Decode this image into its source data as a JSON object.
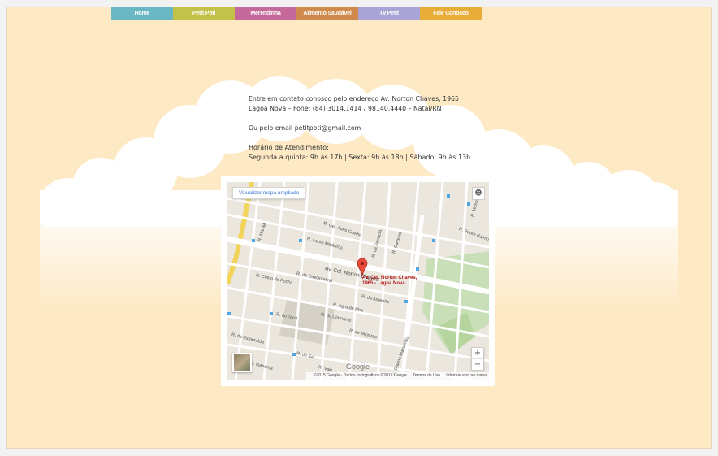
{
  "nav": {
    "items": [
      {
        "label": "Home",
        "color": "#69b7c4"
      },
      {
        "label": "Petit Poti",
        "color": "#c2c24a"
      },
      {
        "label": "Merendinha",
        "color": "#c4699a"
      },
      {
        "label": "Alimento Saudável",
        "color": "#cf8a4b"
      },
      {
        "label": "Tv Petit",
        "color": "#a9a4d6"
      },
      {
        "label": "Fale Conosco",
        "color": "#e8ac38"
      }
    ]
  },
  "contact": {
    "address_line1": "Entre em contato conosco pelo endereço Av. Norton Chaves, 1965",
    "address_line2": "Lagoa Nova – Fone: (84) 3014.1414 / 98140.4440 – Natal/RN",
    "email_prefix": "Ou pelo email ",
    "email": "petitpoti@gmail.com",
    "hours_title": "Horário de Atendimento:",
    "hours_detail": "Segunda a quinta: 9h às 17h | Sexta: 9h às 18h | Sábado: 9h às 13h"
  },
  "map": {
    "view_larger": "Visualizar mapa ampliado",
    "pin_label_line1": "Av. Cel. Norton Chaves,",
    "pin_label_line2": "1965 - Lagoa Nova",
    "google": "Google",
    "zoom_in": "+",
    "zoom_out": "−",
    "attribution": "©2015 Google - Dados cartográficos ©2015 Google",
    "terms": "Termos de Uso",
    "report": "Informar erro no mapa",
    "streets": [
      "Av. Cel. Norton Chaves",
      "R. Cel. Auris Coelho",
      "R. Lauro Medeiros",
      "R. Cristo de Pocha",
      "R. de Cascinheiral",
      "R. da Amenita",
      "R. Agra de Rha",
      "R. do Diamante",
      "R. do Tarol",
      "R. da Esmeralda",
      "R. de Bronzes",
      "R. do Sal",
      "R. Vale",
      "R. Ipanema",
      "R. Djalma Maranhão",
      "R. Padre Raimundo",
      "R. Mossoró",
      "R. da Serracia",
      "R. Caracas",
      "R. Marajá"
    ]
  }
}
